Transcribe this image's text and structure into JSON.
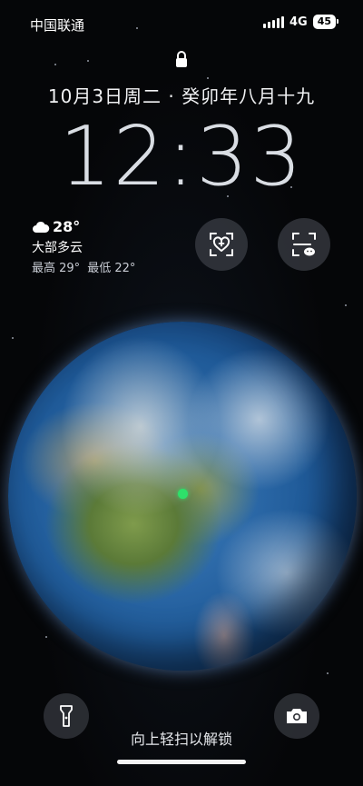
{
  "status_bar": {
    "carrier": "中国联通",
    "network": "4G",
    "battery": "45",
    "icons": [
      "signal-bars-icon",
      "battery-icon"
    ]
  },
  "lock_screen": {
    "lock_icon": "lock-icon",
    "date": "10月3日周二 · 癸卯年八月十九",
    "time": "12:33"
  },
  "weather": {
    "icon": "cloud-icon",
    "temperature": "28°",
    "condition": "大部多云",
    "high": "最高 29°",
    "low": "最低 22°"
  },
  "shortcuts": [
    {
      "icon": "health-code-icon"
    },
    {
      "icon": "wechat-scan-icon"
    }
  ],
  "bottom": {
    "flashlight_icon": "flashlight-icon",
    "camera_icon": "camera-icon",
    "unlock_hint": "向上轻扫以解锁"
  },
  "colors": {
    "background": "#050608",
    "location_dot": "#2ee06a",
    "text": "#ffffff"
  }
}
